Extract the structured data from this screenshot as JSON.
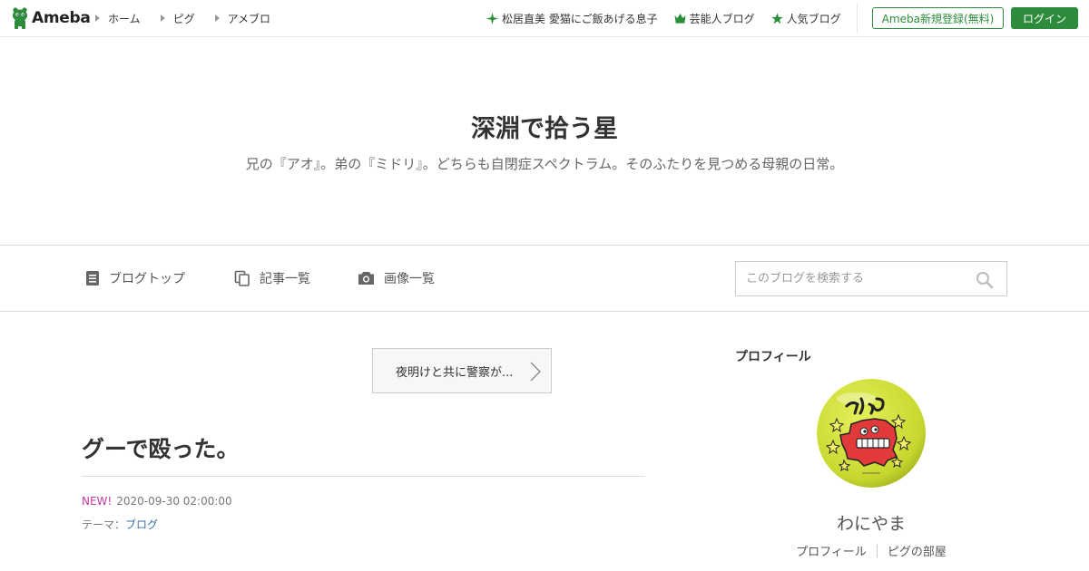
{
  "topbar": {
    "logo_text": "Ameba",
    "nav_left": [
      {
        "label": "ホーム"
      },
      {
        "label": "ピグ"
      },
      {
        "label": "アメブロ"
      }
    ],
    "nav_right": [
      {
        "label": "松居直美 愛猫にご飯あげる息子",
        "icon": "sparkle-icon"
      },
      {
        "label": "芸能人ブログ",
        "icon": "crown-icon"
      },
      {
        "label": "人気ブログ",
        "icon": "star-icon"
      }
    ],
    "register_label": "Ameba新規登録(無料)",
    "login_label": "ログイン",
    "accent_color": "#2d8c3c"
  },
  "header": {
    "title": "深淵で拾う星",
    "description": "兄の『アオ』。弟の『ミドリ』。どちらも自閉症スペクトラム。そのふたりを見つめる母親の日常。"
  },
  "blognav": {
    "items": [
      {
        "label": "ブログトップ",
        "icon": "document-icon"
      },
      {
        "label": "記事一覧",
        "icon": "copy-icon"
      },
      {
        "label": "画像一覧",
        "icon": "camera-icon"
      }
    ],
    "search_placeholder": "このブログを検索する"
  },
  "prev_article": {
    "label": "夜明けと共に警察が..."
  },
  "article": {
    "title": "グーで殴った。",
    "new_badge": "NEW!",
    "datetime": "2020-09-30 02:00:00",
    "theme_prefix": "テーマ：",
    "theme_link": "ブログ"
  },
  "sidebar": {
    "heading": "プロフィール",
    "name": "わにやま",
    "links": [
      {
        "label": "プロフィール"
      },
      {
        "label": "ピグの部屋"
      }
    ]
  }
}
